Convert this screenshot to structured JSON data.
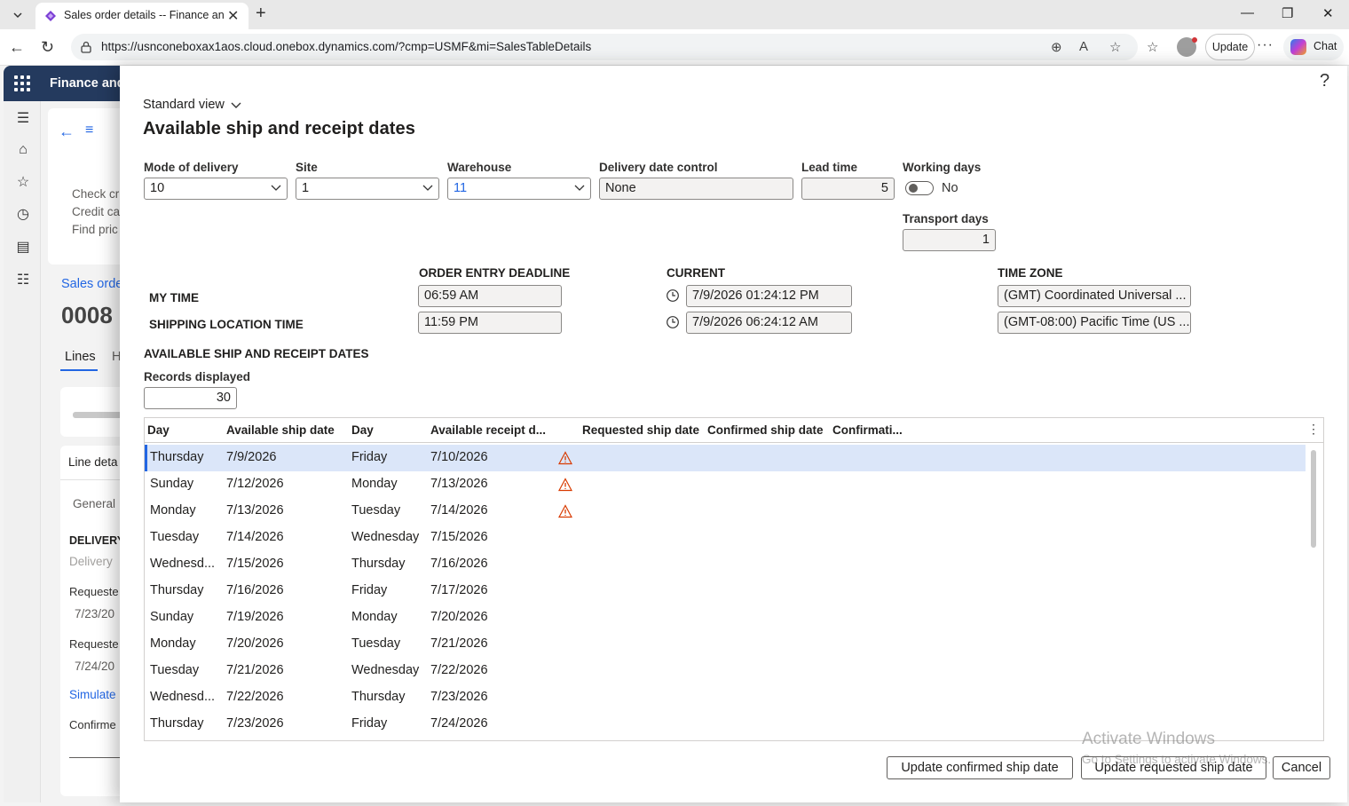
{
  "browser": {
    "tab_title": "Sales order details -- Finance and",
    "url": "https://usnconeboxax1aos.cloud.onebox.dynamics.com/?cmp=USMF&mi=SalesTableDetails",
    "update_label": "Update",
    "chat_label": "Chat"
  },
  "app": {
    "name": "Finance and",
    "bg_items": [
      "Check cr",
      "Credit ca",
      "Find pric"
    ],
    "bg_breadcrumb": "Sales orde",
    "bg_order_number": "0008",
    "bg_tab_lines": "Lines",
    "bg_tab_h": "H",
    "bg_line_details": "Line deta",
    "bg_general": "General",
    "bg_delivery": "DELIVERY",
    "bg_delivery_sub": "Delivery",
    "bg_requested1": "Requeste",
    "bg_date1": "7/23/20",
    "bg_requested2": "Requeste",
    "bg_date2": "7/24/20",
    "bg_simulate": "Simulate",
    "bg_confirmed": "Confirme"
  },
  "dialog": {
    "view_label": "Standard view",
    "title": "Available ship and receipt dates",
    "fields": {
      "mode_of_delivery": {
        "label": "Mode of delivery",
        "value": "10"
      },
      "site": {
        "label": "Site",
        "value": "1"
      },
      "warehouse": {
        "label": "Warehouse",
        "value": "11"
      },
      "delivery_date_control": {
        "label": "Delivery date control",
        "value": "None"
      },
      "lead_time": {
        "label": "Lead time",
        "value": "5"
      },
      "working_days": {
        "label": "Working days",
        "value": "No"
      },
      "transport_days": {
        "label": "Transport days",
        "value": "1"
      }
    },
    "time_table": {
      "col_order_entry": "ORDER ENTRY DEADLINE",
      "col_current": "CURRENT",
      "col_time_zone": "TIME ZONE",
      "rows": [
        {
          "label": "MY TIME",
          "deadline": "06:59 AM",
          "current": "7/9/2026 01:24:12 PM",
          "zone": "(GMT) Coordinated Universal ..."
        },
        {
          "label": "SHIPPING LOCATION TIME",
          "deadline": "11:59 PM",
          "current": "7/9/2026 06:24:12 AM",
          "zone": "(GMT-08:00) Pacific Time (US ..."
        }
      ]
    },
    "available_section": "AVAILABLE SHIP AND RECEIPT DATES",
    "records_displayed": {
      "label": "Records displayed",
      "value": "30"
    },
    "grid": {
      "headers": [
        "Day",
        "Available ship date",
        "Day",
        "Available receipt d...",
        "Requested ship date",
        "Confirmed ship date",
        "Confirmati..."
      ],
      "rows": [
        {
          "day1": "Thursday",
          "ship": "7/9/2026",
          "day2": "Friday",
          "receipt": "7/10/2026",
          "warn": true
        },
        {
          "day1": "Sunday",
          "ship": "7/12/2026",
          "day2": "Monday",
          "receipt": "7/13/2026",
          "warn": true
        },
        {
          "day1": "Monday",
          "ship": "7/13/2026",
          "day2": "Tuesday",
          "receipt": "7/14/2026",
          "warn": true
        },
        {
          "day1": "Tuesday",
          "ship": "7/14/2026",
          "day2": "Wednesday",
          "receipt": "7/15/2026",
          "warn": false
        },
        {
          "day1": "Wednesd...",
          "ship": "7/15/2026",
          "day2": "Thursday",
          "receipt": "7/16/2026",
          "warn": false
        },
        {
          "day1": "Thursday",
          "ship": "7/16/2026",
          "day2": "Friday",
          "receipt": "7/17/2026",
          "warn": false
        },
        {
          "day1": "Sunday",
          "ship": "7/19/2026",
          "day2": "Monday",
          "receipt": "7/20/2026",
          "warn": false
        },
        {
          "day1": "Monday",
          "ship": "7/20/2026",
          "day2": "Tuesday",
          "receipt": "7/21/2026",
          "warn": false
        },
        {
          "day1": "Tuesday",
          "ship": "7/21/2026",
          "day2": "Wednesday",
          "receipt": "7/22/2026",
          "warn": false
        },
        {
          "day1": "Wednesd...",
          "ship": "7/22/2026",
          "day2": "Thursday",
          "receipt": "7/23/2026",
          "warn": false
        },
        {
          "day1": "Thursday",
          "ship": "7/23/2026",
          "day2": "Friday",
          "receipt": "7/24/2026",
          "warn": false
        }
      ]
    },
    "buttons": {
      "update_confirmed": "Update confirmed ship date",
      "update_requested": "Update requested ship date",
      "cancel": "Cancel"
    },
    "watermark": {
      "line1": "Activate Windows",
      "line2": "Go to Settings to activate Windows."
    }
  }
}
